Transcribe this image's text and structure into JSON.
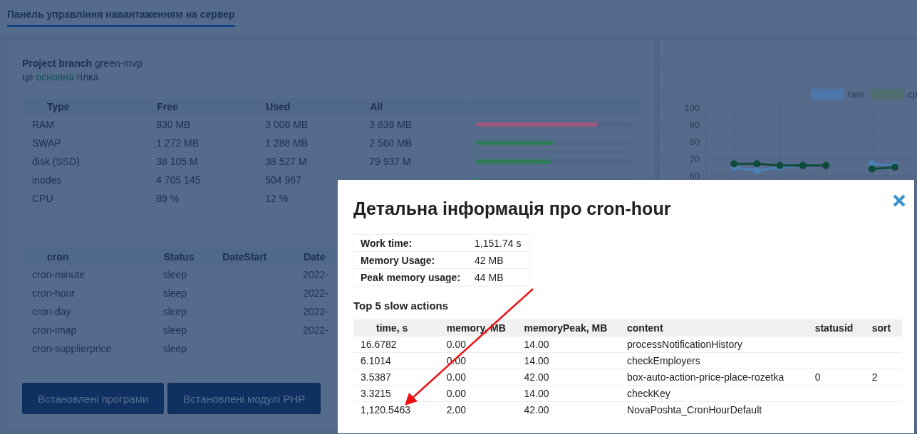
{
  "header": {
    "tab": {
      "label": "Панель управління навантаженням на сервер",
      "selected": true
    }
  },
  "branch": {
    "label": "Project branch",
    "name": "green-mvp",
    "note_prefix": "це",
    "note_highlight": "основна",
    "note_suffix": "гілка"
  },
  "resources": {
    "columns": [
      "Type",
      "Free",
      "Used",
      "All"
    ],
    "rows": [
      {
        "type": "RAM",
        "free": "830 MB",
        "used": "3 008 MB",
        "all": "3 838 MB",
        "level": 0.78,
        "color": "#9c5a80"
      },
      {
        "type": "SWAP",
        "free": "1 272 MB",
        "used": "1 288 MB",
        "all": "2 560 MB",
        "level": 0.5,
        "color": "#2e7d5a"
      },
      {
        "type": "disk (SSD)",
        "free": "38 105 M",
        "used": "38 527 M",
        "all": "79 937 M",
        "level": 0.48,
        "color": "#2e7d5a"
      },
      {
        "type": "inodes",
        "free": "4 705 145",
        "used": "504 967",
        "level": 0.02,
        "color": "#2e7d5a"
      },
      {
        "type": "CPU",
        "free": "89 %",
        "used": "12 %"
      }
    ]
  },
  "cron_table": {
    "columns": [
      "cron",
      "Status",
      "DateStart",
      "Date"
    ],
    "rows": [
      {
        "name": "cron-minute",
        "status": "sleep",
        "date": "2022-"
      },
      {
        "name": "cron-hour",
        "status": "sleep",
        "date": "2022-"
      },
      {
        "name": "cron-day",
        "status": "sleep",
        "date": "2022-"
      },
      {
        "name": "cron-imap",
        "status": "sleep",
        "date": "2022-"
      },
      {
        "name": "cron-supplierprice",
        "status": "sleep"
      }
    ]
  },
  "buttons": [
    "Встановлені програми",
    "Встановлені модулі PHP"
  ],
  "chart": {
    "legend": [
      {
        "name": "ram",
        "color": "#4a77a8"
      },
      {
        "name": "cp",
        "color": "#4f6f6e"
      }
    ],
    "y_axis_labels": [
      "100",
      "90",
      "80",
      "70",
      "60"
    ]
  },
  "modal": {
    "title": "Детальна інформація про cron-hour",
    "info": [
      {
        "label": "Work time:",
        "value": "1,151.74 s"
      },
      {
        "label": "Memory Usage:",
        "value": "42 MB"
      },
      {
        "label": "Peak memory usage:",
        "value": "44 MB"
      }
    ],
    "section_title": "Top 5 slow actions",
    "columns": [
      "time, s",
      "memory, MB",
      "memoryPeak, MB",
      "content",
      "statusid",
      "sort"
    ],
    "rows": [
      [
        "16.6782",
        "0.00",
        "14.00",
        "processNotificationHistory",
        "",
        ""
      ],
      [
        "6.1014",
        "0.00",
        "14.00",
        "checkEmployers",
        "",
        ""
      ],
      [
        "3.5387",
        "0.00",
        "42.00",
        "box-auto-action-price-place-rozetka",
        "0",
        "2"
      ],
      [
        "3.3215",
        "0.00",
        "14.00",
        "checkKey",
        "",
        ""
      ],
      [
        "1,120.5463",
        "2.00",
        "42.00",
        "NovaPoshta_CronHourDefault",
        "",
        ""
      ]
    ]
  }
}
